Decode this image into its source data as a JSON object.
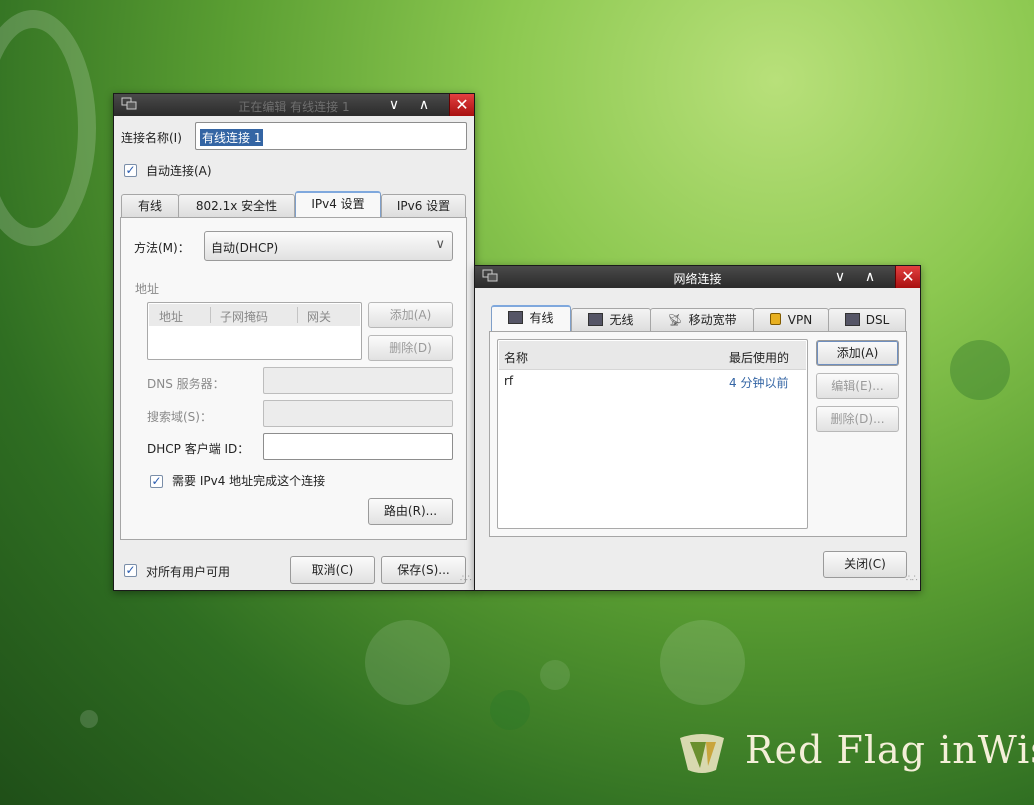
{
  "colors": {
    "accent": "#3465a4",
    "title_bar": "#2b2b2b",
    "close": "#c42020",
    "link_blue": "#3465a4"
  },
  "editor": {
    "title": "正在编辑 有线连接 1",
    "conn_name_label": "连接名称(I)",
    "conn_name_value": "有线连接 1",
    "auto_connect_label": "自动连接(A)",
    "tabs": [
      "有线",
      "802.1x 安全性",
      "IPv4 设置",
      "IPv6 设置"
    ],
    "method_label": "方法(M)：",
    "method_value": "自动(DHCP)",
    "address_section": "地址",
    "address_columns": [
      "地址",
      "子网掩码",
      "网关"
    ],
    "add_button": "添加(A)",
    "delete_button": "删除(D)",
    "dns_label": "DNS 服务器：",
    "search_label": "搜索域(S)：",
    "dhcp_label": "DHCP 客户端 ID：",
    "require_ipv4_label": "需要 IPv4 地址完成这个连接",
    "routes_button": "路由(R)...",
    "all_users_label": "对所有用户可用",
    "cancel_button": "取消(C)",
    "save_button": "保存(S)..."
  },
  "network": {
    "title": "网络连接",
    "tabs": [
      "有线",
      "无线",
      "移动宽带",
      "VPN",
      "DSL"
    ],
    "columns": [
      "名称",
      "最后使用的"
    ],
    "rows": [
      {
        "name": "rf",
        "last_used": "4 分钟以前"
      }
    ],
    "add_button": "添加(A)",
    "edit_button": "编辑(E)...",
    "delete_button": "删除(D)...",
    "close_button": "关闭(C)"
  },
  "desktop": {
    "brand": "Red Flag inWis"
  }
}
